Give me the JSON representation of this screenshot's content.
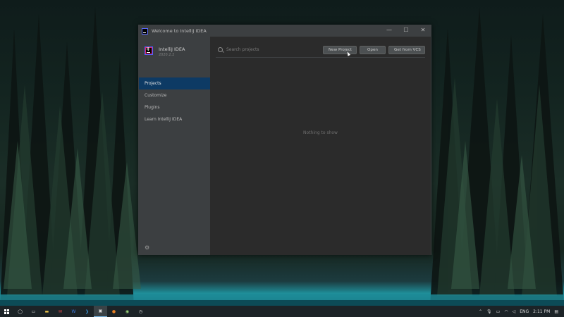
{
  "window": {
    "title": "Welcome to IntelliJ IDEA",
    "controls": [
      "—",
      "☐",
      "✕"
    ]
  },
  "product": {
    "name": "IntelliJ IDEA",
    "version": "2020.2.2"
  },
  "sidebar": {
    "items": [
      {
        "label": "Projects",
        "active": true
      },
      {
        "label": "Customize",
        "active": false
      },
      {
        "label": "Plugins",
        "active": false
      },
      {
        "label": "Learn IntelliJ IDEA",
        "active": false
      }
    ],
    "settings_icon": "gear-icon"
  },
  "main": {
    "search": {
      "placeholder": "Search projects",
      "value": ""
    },
    "buttons": {
      "new_project": "New Project",
      "open": "Open",
      "get_from_vcs": "Get from VCS"
    },
    "empty_text": "Nothing to show"
  },
  "taskbar": {
    "icons": [
      "windows-start-icon",
      "cortana-icon",
      "task-view-icon",
      "file-explorer-icon",
      "mail-icon",
      "word-icon",
      "vscode-icon",
      "intellij-icon",
      "firefox-icon",
      "chrome-icon",
      "clock-app-icon"
    ],
    "language": "ENG",
    "time": "2:11 PM"
  },
  "colors": {
    "accent_selected": "#0d3a64",
    "window_bg": "#2b2b2b",
    "sidebar_bg": "#3c3f41",
    "taskbar_bg": "#1c2327"
  }
}
